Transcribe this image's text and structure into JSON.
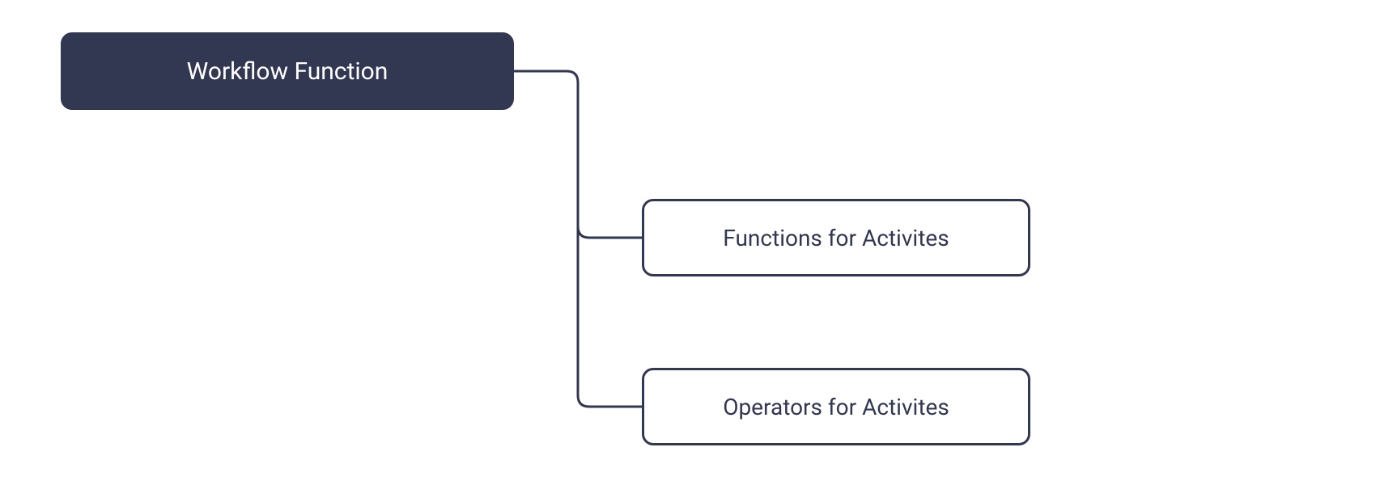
{
  "diagram": {
    "root": {
      "label": "Workflow Function"
    },
    "children": [
      {
        "label": "Functions for Activites"
      },
      {
        "label": "Operators for Activites"
      }
    ],
    "colors": {
      "primary": "#323752",
      "background": "#ffffff"
    }
  }
}
